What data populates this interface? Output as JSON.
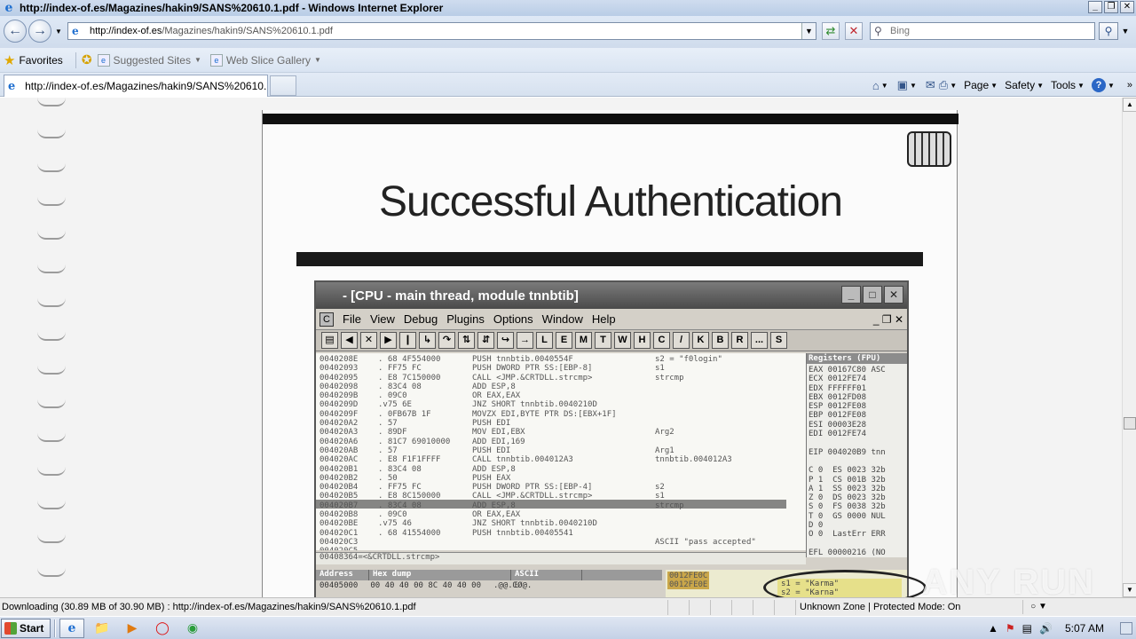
{
  "window": {
    "title": "http://index-of.es/Magazines/hakin9/SANS%20610.1.pdf - Windows Internet Explorer",
    "ctrl_min": "_",
    "ctrl_max": "❐",
    "ctrl_close": "✕"
  },
  "address_bar": {
    "url_host": "http://index-of.es",
    "url_path": "/Magazines/hakin9/SANS%20610.1.pdf"
  },
  "search": {
    "placeholder": "Bing"
  },
  "favorites_bar": {
    "favorites_label": "Favorites",
    "suggested_sites_label": "Suggested Sites",
    "web_slice_gallery_label": "Web Slice Gallery"
  },
  "tab": {
    "label": "http://index-of.es/Magazines/hakin9/SANS%20610.1..."
  },
  "command_bar": {
    "page_label": "Page",
    "safety_label": "Safety",
    "tools_label": "Tools"
  },
  "document": {
    "slide_title": "Successful Authentication",
    "debugger_title": "- [CPU - main thread, module tnnbtib]",
    "menu": [
      "File",
      "View",
      "Debug",
      "Plugins",
      "Options",
      "Window",
      "Help"
    ],
    "toolbar_letters": [
      "L",
      "E",
      "M",
      "T",
      "W",
      "H",
      "C",
      "/",
      "K",
      "B",
      "R",
      "...",
      "S"
    ],
    "addresses": "0040208E\n00402093\n00402095\n00402098\n0040209B\n0040209D\n0040209F\n004020A2\n004020A3\n004020A6\n004020AB\n004020AC\n004020B1\n004020B2\n004020B4\n004020B5\n004020B7\n004020B8\n004020BE\n004020C1\n004020C3\n004020C5",
    "hex": ". 68 4F554000\n. FF75 FC\n. E8 7C150000\n. 83C4 08\n. 09C0\n.v75 6E\n. 0FB67B 1F\n. 57\n. 89DF\n. 81C7 69010000\n. 57\n. E8 F1F1FFFF\n. 83C4 08\n. 50\n. FF75 FC\n. E8 8C150000\n. 83C4 08\n. 09C0\n.v75 46\n. 68 41554000",
    "disasm": "PUSH tnnbtib.0040554F\nPUSH DWORD PTR SS:[EBP-8]\nCALL <JMP.&CRTDLL.strcmp>\nADD ESP,8\nOR EAX,EAX\nJNZ SHORT tnnbtib.0040210D\nMOVZX EDI,BYTE PTR DS:[EBX+1F]\nPUSH EDI\nMOV EDI,EBX\nADD EDI,169\nPUSH EDI\nCALL tnnbtib.004012A3\nADD ESP,8\nPUSH EAX\nPUSH DWORD PTR SS:[EBP-4]\nCALL <JMP.&CRTDLL.strcmp>\nADD ESP,8\nOR EAX,EAX\nJNZ SHORT tnnbtib.0040210D\nPUSH tnnbtib.00405541",
    "comments": "s2 = \"f0login\"\ns1\nstrcmp\n\n\n\n\n\nArg2\n\nArg1\ntnnbtib.004012A3\n\n\ns2\ns1\nstrcmp\n\n\n\nASCII \"pass accepted\"",
    "regs_header": "Registers (FPU)",
    "regs": "EAX 00167C80 ASC\nECX 0012FE74\nEDX FFFFFF01\nEBX 0012FD08\nESP 0012FE08\nEBP 0012FE08\nESI 00003E28\nEDI 0012FE74\n\nEIP 004020B9 tnn\n\nC 0  ES 0023 32b\nP 1  CS 001B 32b\nA 1  SS 0023 32b\nZ 0  DS 0023 32b\nS 0  FS 0038 32b\nT 0  GS 0000 NUL\nD 0\nO 0  LastErr ERR\n\nEFL 00000216 (NO",
    "cmdline": "00408364=<&CRTDLL.strcmp>",
    "dump_address_label": "Address",
    "dump_hex_label": "Hex dump",
    "dump_ascii_label": "ASCII",
    "dump_row_addr": "00405000",
    "dump_row_hex": "00 40 40 00 8C 40 40 00",
    "dump_row_ascii": ".@@.ŒØ@.",
    "stack_line1": "s1 = \"Karma\"",
    "stack_line2": "s2 = \"Karna\"",
    "stack_addr1": "0012FE0C",
    "stack_addr2": "0012FE0E"
  },
  "watermark": "ANY RUN",
  "status_bar": {
    "text": "Downloading (30.89 MB of 30.90 MB) : http://index-of.es/Magazines/hakin9/SANS%20610.1.pdf",
    "zone": "Unknown Zone | Protected Mode: On"
  },
  "taskbar": {
    "start_label": "Start",
    "clock": "5:07 AM"
  },
  "colors": {
    "accent": "#1f6fd0",
    "titlebar": "#b9cde6",
    "slide_bar": "#111111"
  }
}
